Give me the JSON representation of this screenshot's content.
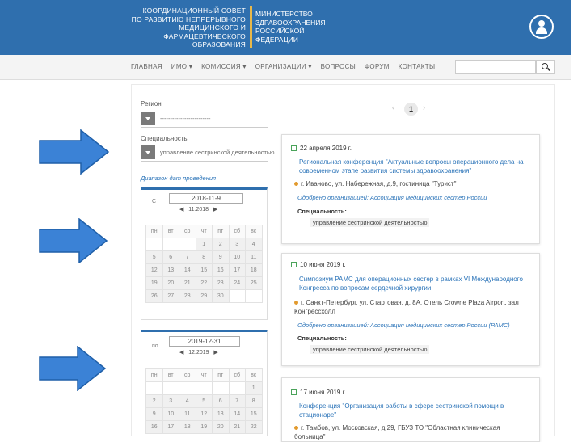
{
  "header": {
    "council_lines": [
      "КООРДИНАЦИОННЫЙ СОВЕТ",
      "ПО РАЗВИТИЮ НЕПРЕРЫВНОГО",
      "МЕДИЦИНСКОГО И",
      "ФАРМАЦЕВТИЧЕСКОГО",
      "ОБРАЗОВАНИЯ"
    ],
    "ministry_lines": [
      "МИНИСТЕРСТВО",
      "ЗДРАВООХРАНЕНИЯ",
      "РОССИЙСКОЙ",
      "ФЕДЕРАЦИИ"
    ],
    "brand_color": "#2f6fae",
    "accent_color": "#e8b84a",
    "avatar_icon": "user-icon"
  },
  "nav": {
    "items": [
      "ГЛАВНАЯ",
      "ИМО ▾",
      "КОМИССИЯ ▾",
      "ОРГАНИЗАЦИИ ▾",
      "ВОПРОСЫ",
      "ФОРУМ",
      "КОНТАКТЫ"
    ],
    "search_placeholder": "",
    "search_icon": "search-icon"
  },
  "filters": {
    "region_label": "Регион",
    "region_value": "-------------------------",
    "specialty_label": "Специальность",
    "specialty_value": "управление сестринской деятельностью",
    "date_range_link": "Диапазон дат проведения"
  },
  "calendar_from": {
    "side_label": "С",
    "input_value": "2018-11-9",
    "prev": "◀",
    "month": "11.2018",
    "next": "▶",
    "weekdays": [
      "пн",
      "вт",
      "ср",
      "чт",
      "пт",
      "сб",
      "вс"
    ],
    "days": [
      "",
      "",
      "",
      "1",
      "2",
      "3",
      "4",
      "5",
      "6",
      "7",
      "8",
      "9",
      "10",
      "11",
      "12",
      "13",
      "14",
      "15",
      "16",
      "17",
      "18",
      "19",
      "20",
      "21",
      "22",
      "23",
      "24",
      "25",
      "26",
      "27",
      "28",
      "29",
      "30",
      "",
      ""
    ]
  },
  "calendar_to": {
    "side_label": "по",
    "input_value": "2019-12-31",
    "prev": "◀",
    "month": "12.2019",
    "next": "▶",
    "weekdays": [
      "пн",
      "вт",
      "ср",
      "чт",
      "пт",
      "сб",
      "вс"
    ],
    "days": [
      "",
      "",
      "",
      "",
      "",
      "",
      "1",
      "2",
      "3",
      "4",
      "5",
      "6",
      "7",
      "8",
      "9",
      "10",
      "11",
      "12",
      "13",
      "14",
      "15",
      "16",
      "17",
      "18",
      "19",
      "20",
      "21",
      "22"
    ]
  },
  "pagination": {
    "prev": "‹",
    "current": "1",
    "next": "›"
  },
  "events": [
    {
      "date": "22 апреля 2019 г.",
      "title": "Региональная конференция \"Актуальные вопросы операционного дела на современном этапе развития системы здравоохранения\"",
      "location": "г. Иваново, ул. Набережная, д.9, гостиница \"Турист\"",
      "organizer": "Одобрено организацией: Ассоциация медицинских сестер России",
      "specialty_label": "Специальность:",
      "specialty": "управление сестринской деятельностью"
    },
    {
      "date": "10 июня 2019 г.",
      "title": "Симпозиум РАМС для операционных сестер в рамках VI Международного Конгресса по вопросам сердечной хирургии",
      "location": "г. Санкт-Петербург, ул. Стартовая, д. 8А, Отель Crowne Plaza Airport, зал Конгрессхолл",
      "organizer": "Одобрено организацией: Ассоциация медицинских сестер России (РАМС)",
      "specialty_label": "Специальность:",
      "specialty": "управление сестринской деятельностью"
    },
    {
      "date": "17 июня 2019 г.",
      "title": "Конференция \"Организация работы в сфере сестринской помощи в стационаре\"",
      "location": "г. Тамбов, ул. Московская, д.29, ГБУЗ ТО \"Областная клиническая больница\"",
      "organizer": "",
      "specialty_label": "",
      "specialty": ""
    }
  ]
}
